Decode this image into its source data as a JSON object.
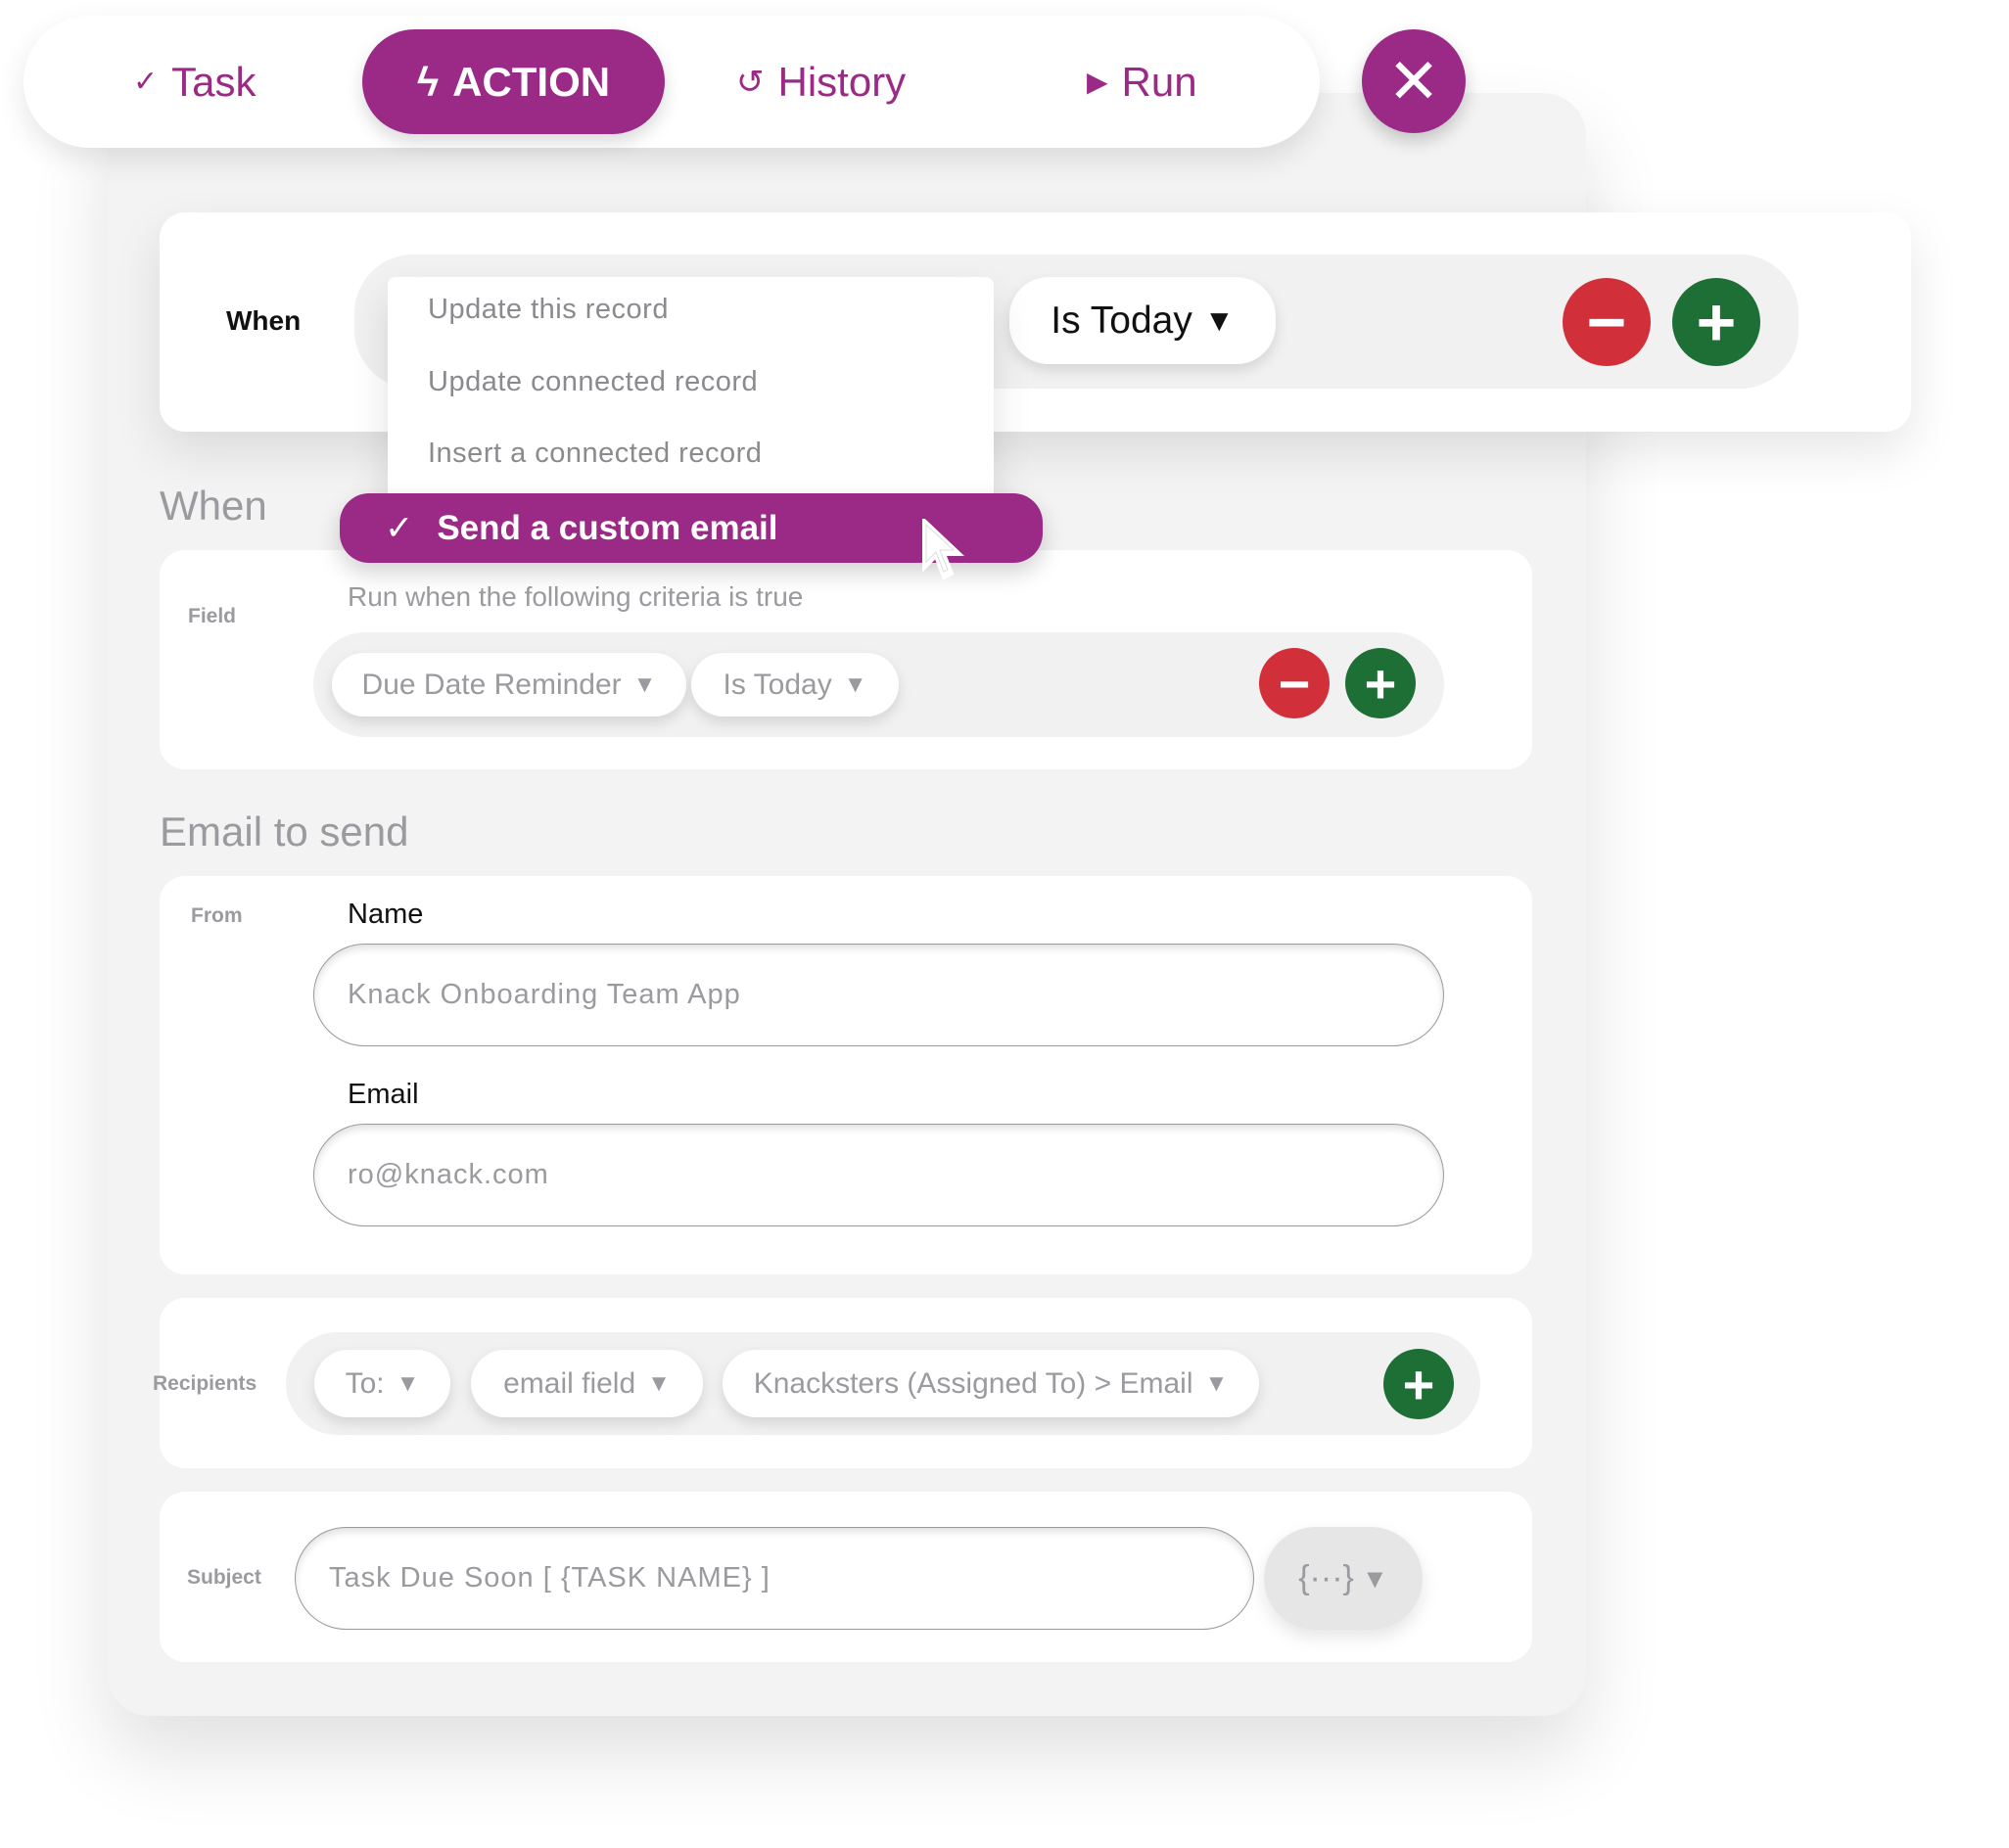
{
  "tabs": [
    {
      "label": "Task",
      "icon": "check-icon",
      "glyph": "✓"
    },
    {
      "label": "ACTION",
      "icon": "bolt-icon",
      "glyph": "ϟ"
    },
    {
      "label": "History",
      "icon": "history-icon",
      "glyph": "↺"
    },
    {
      "label": "Run",
      "icon": "play-icon",
      "glyph": "▶"
    }
  ],
  "close_glyph": "✕",
  "top_rule": {
    "label": "When",
    "operator": "Is Today",
    "minus": "−",
    "plus": "+"
  },
  "action_menu": {
    "options": [
      "Update this record",
      "Update connected record",
      "Insert a connected record"
    ],
    "selected": "Send a custom email"
  },
  "when": {
    "heading": "When",
    "field_label": "Field",
    "hint": "Run when the following criteria is true",
    "field": "Due Date Reminder",
    "operator": "Is Today"
  },
  "email": {
    "heading": "Email to send",
    "from_label": "From",
    "name_label": "Name",
    "name_value": "Knack Onboarding Team App",
    "email_label": "Email",
    "email_value": "ro@knack.com",
    "recipients_label": "Recipients",
    "to": "To:",
    "type": "email field",
    "recipient": "Knacksters (Assigned To) > Email",
    "subject_label": "Subject",
    "subject_value": "Task Due Soon [ {TASK NAME} ]",
    "var_glyph": "{···}"
  },
  "colors": {
    "accent": "#9b2a87",
    "remove": "#d12f3a",
    "add": "#1e6f35"
  }
}
